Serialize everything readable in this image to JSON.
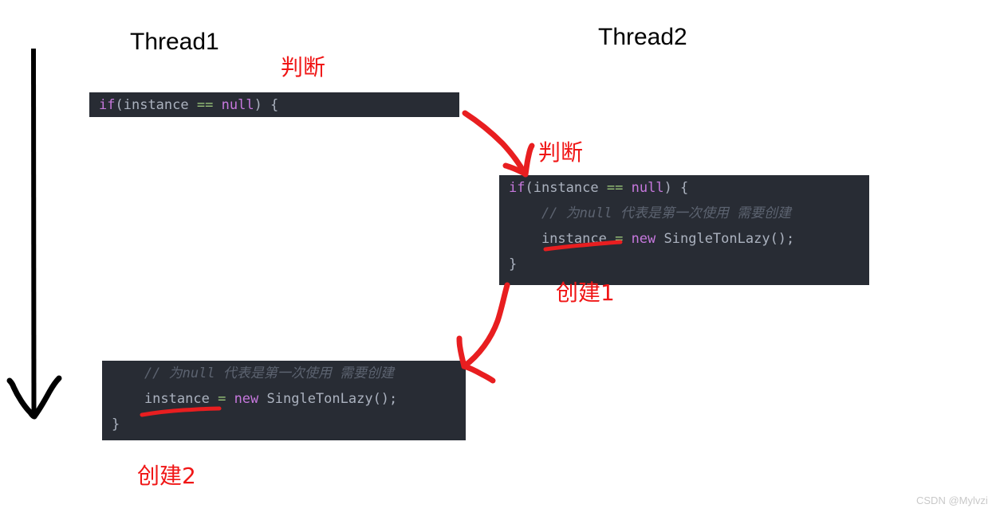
{
  "meta": {
    "background_color": "#ffffff",
    "code_bg_color": "#282c34",
    "annotation_color": "#f01616",
    "arrow_color": "#000000"
  },
  "threads": [
    {
      "id": "thread1",
      "label": "Thread1"
    },
    {
      "id": "thread2",
      "label": "Thread2"
    }
  ],
  "code_blocks": [
    {
      "id": "thread1-check",
      "lines": [
        [
          {
            "t": "if",
            "c": "kw"
          },
          {
            "t": "(",
            "c": "punc"
          },
          {
            "t": "instance",
            "c": "plain"
          },
          {
            "t": " ",
            "c": "plain"
          },
          {
            "t": "==",
            "c": "op"
          },
          {
            "t": " ",
            "c": "plain"
          },
          {
            "t": "null",
            "c": "kw"
          },
          {
            "t": ")",
            "c": "punc"
          },
          {
            "t": " {",
            "c": "punc"
          }
        ]
      ]
    },
    {
      "id": "thread2-check-create",
      "lines": [
        [
          {
            "t": "if",
            "c": "kw"
          },
          {
            "t": "(",
            "c": "punc"
          },
          {
            "t": "instance",
            "c": "plain"
          },
          {
            "t": " ",
            "c": "plain"
          },
          {
            "t": "==",
            "c": "op"
          },
          {
            "t": " ",
            "c": "plain"
          },
          {
            "t": "null",
            "c": "kw"
          },
          {
            "t": ")",
            "c": "punc"
          },
          {
            "t": " {",
            "c": "punc"
          }
        ],
        [
          {
            "t": "    // 为null 代表是第一次使用 需要创建",
            "c": "comment"
          }
        ],
        [
          {
            "t": "    instance ",
            "c": "plain"
          },
          {
            "t": "=",
            "c": "op"
          },
          {
            "t": " ",
            "c": "plain"
          },
          {
            "t": "new",
            "c": "new"
          },
          {
            "t": " SingleTonLazy();",
            "c": "type"
          }
        ],
        [
          {
            "t": "}",
            "c": "punc"
          }
        ]
      ]
    },
    {
      "id": "thread1-create",
      "lines": [
        [
          {
            "t": "    // 为null 代表是第一次使用 需要创建",
            "c": "comment"
          }
        ],
        [
          {
            "t": "    instance ",
            "c": "plain"
          },
          {
            "t": "=",
            "c": "op"
          },
          {
            "t": " ",
            "c": "plain"
          },
          {
            "t": "new",
            "c": "new"
          },
          {
            "t": " SingleTonLazy();",
            "c": "type"
          }
        ],
        [
          {
            "t": "}",
            "c": "punc"
          }
        ]
      ]
    }
  ],
  "annotations": [
    {
      "id": "annot-check-1",
      "label": "判断"
    },
    {
      "id": "annot-check-2",
      "label": "判断"
    },
    {
      "id": "annot-create-1",
      "label": "创建1"
    },
    {
      "id": "annot-create-2",
      "label": "创建2"
    }
  ],
  "icons": {
    "timeline_arrow": "down-arrow-icon",
    "flow_arrow_1": "curved-arrow-icon",
    "flow_arrow_2": "curved-arrow-icon",
    "underline_1": "red-underline-icon",
    "underline_2": "red-underline-icon"
  },
  "watermark": {
    "text": "CSDN @Mylvzi"
  }
}
